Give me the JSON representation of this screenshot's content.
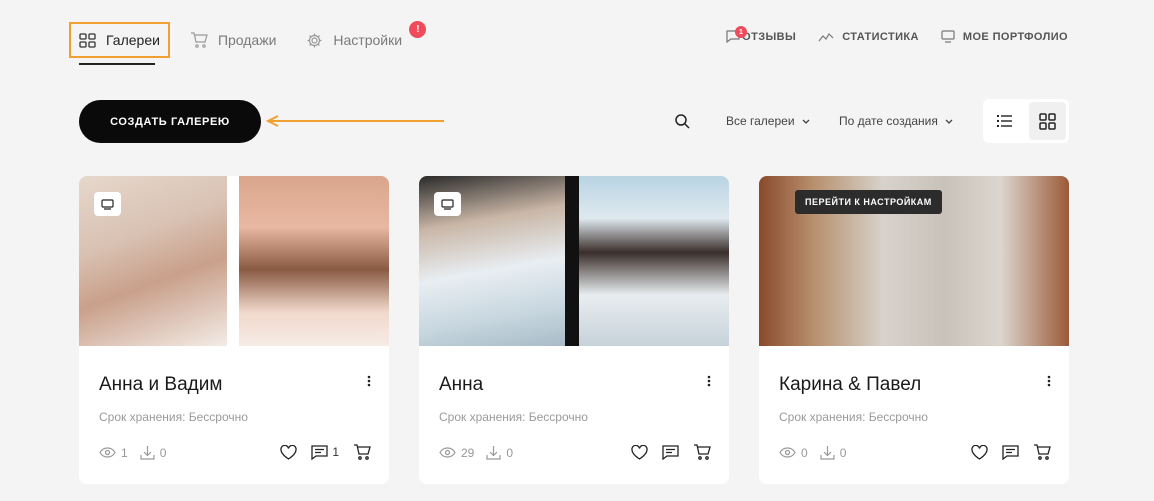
{
  "nav": {
    "galleries": "Галереи",
    "sales": "Продажи",
    "settings": "Настройки",
    "settings_badge": "!",
    "reviews": "ОТЗЫВЫ",
    "reviews_badge": "1",
    "statistics": "СТАТИСТИКА",
    "portfolio": "МОЕ ПОРТФОЛИО"
  },
  "toolbar": {
    "create_label": "СОЗДАТЬ ГАЛЕРЕЮ",
    "filter_label": "Все галереи",
    "sort_label": "По дате создания"
  },
  "cards": [
    {
      "title": "Анна и Вадим",
      "storage": "Срок хранения: Бессрочно",
      "views": "1",
      "downloads": "0",
      "comments": "1"
    },
    {
      "title": "Анна",
      "storage": "Срок хранения: Бессрочно",
      "views": "29",
      "downloads": "0",
      "comments": ""
    },
    {
      "title": "Карина & Павел",
      "storage": "Срок хранения: Бессрочно",
      "views": "0",
      "downloads": "0",
      "comments": "",
      "cover_button": "ПЕРЕЙТИ К НАСТРОЙКАМ"
    }
  ],
  "colors": {
    "accent_orange": "#f0a030",
    "badge_red": "#f04b5b",
    "primary_button": "#0a0a0a"
  }
}
